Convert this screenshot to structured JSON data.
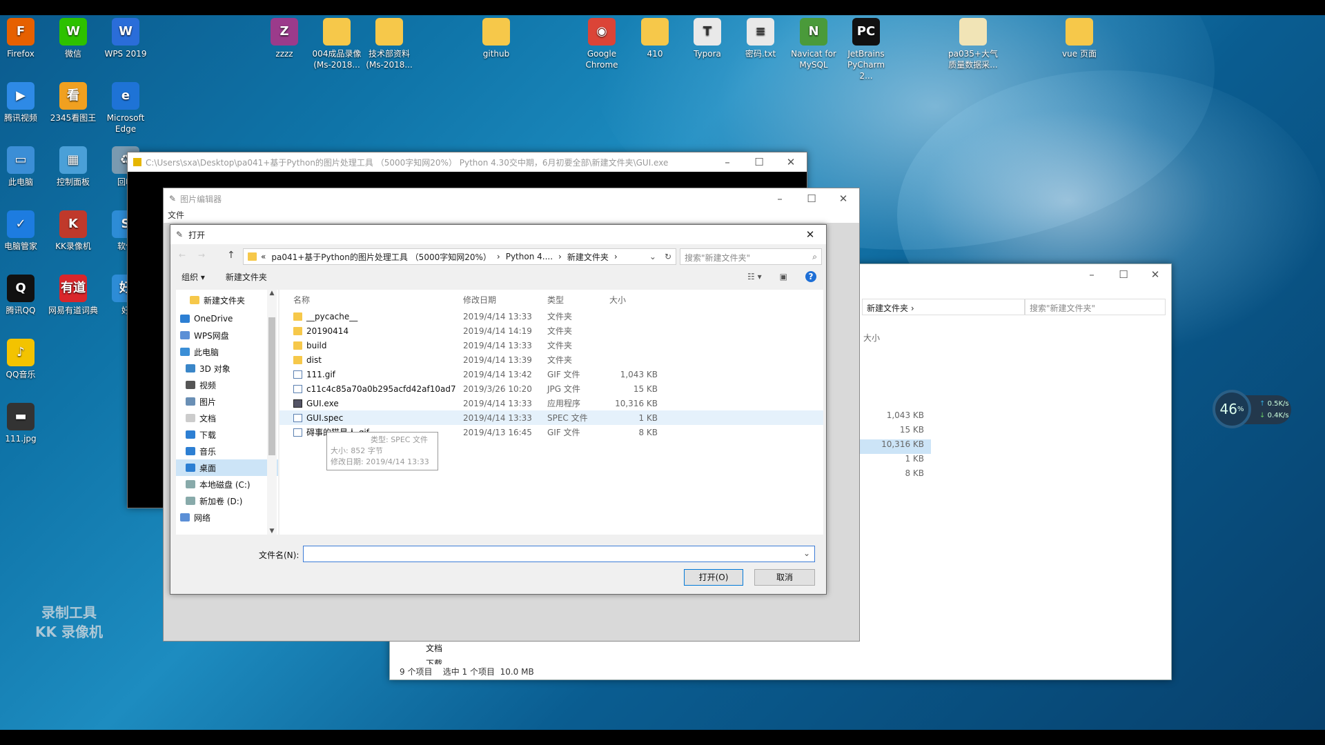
{
  "desktop_icons": [
    {
      "id": "firefox",
      "label": "Firefox",
      "glyph": "F",
      "color": "#e66000"
    },
    {
      "id": "wechat",
      "label": "微信",
      "glyph": "W",
      "color": "#2dc100"
    },
    {
      "id": "wps",
      "label": "WPS 2019",
      "glyph": "W",
      "color": "#2a6dd9"
    },
    {
      "id": "zzzz",
      "label": "zzzz",
      "glyph": "Z",
      "color": "#9b3b8b"
    },
    {
      "id": "rec004",
      "label": "004成品录像\n(Ms-2018...",
      "glyph": "",
      "color": "#f6c84a"
    },
    {
      "id": "tech",
      "label": "技术部资料\n(Ms-2018...",
      "glyph": "",
      "color": "#f6c84a"
    },
    {
      "id": "github",
      "label": "github",
      "glyph": "",
      "color": "#f6c84a"
    },
    {
      "id": "chrome",
      "label": "Google\nChrome",
      "glyph": "◉",
      "color": "#db4437"
    },
    {
      "id": "f410",
      "label": "410",
      "glyph": "",
      "color": "#f6c84a"
    },
    {
      "id": "typora",
      "label": "Typora",
      "glyph": "T",
      "color": "#e9e9e9"
    },
    {
      "id": "pwd",
      "label": "密码.txt",
      "glyph": "≡",
      "color": "#e9e9e9"
    },
    {
      "id": "navicat",
      "label": "Navicat for\nMySQL",
      "glyph": "N",
      "color": "#4a9a3a"
    },
    {
      "id": "pycharm",
      "label": "JetBrains\nPyCharm 2...",
      "glyph": "PC",
      "color": "#111"
    },
    {
      "id": "pa035",
      "label": "pa035+大气\n质量数据采...",
      "glyph": "",
      "color": "#f1e4b6"
    },
    {
      "id": "vue",
      "label": "vue 页面",
      "glyph": "",
      "color": "#f6c84a"
    },
    {
      "id": "tencentvideo",
      "label": "腾讯视频",
      "glyph": "▶",
      "color": "#2e8ae6"
    },
    {
      "id": "viewer2345",
      "label": "2345看图王",
      "glyph": "看",
      "color": "#f0a020"
    },
    {
      "id": "edge",
      "label": "Microsoft\nEdge",
      "glyph": "e",
      "color": "#1e73d6"
    },
    {
      "id": "thispc",
      "label": "此电脑",
      "glyph": "▭",
      "color": "#3b8ed6"
    },
    {
      "id": "controlpanel",
      "label": "控制面板",
      "glyph": "▦",
      "color": "#4aa0d8"
    },
    {
      "id": "recycle",
      "label": "回收",
      "glyph": "♻",
      "color": "#7a9ab0"
    },
    {
      "id": "pcmanager",
      "label": "电脑管家",
      "glyph": "✓",
      "color": "#1d7ce0"
    },
    {
      "id": "kkrec",
      "label": "KK录像机",
      "glyph": "K",
      "color": "#c0392b"
    },
    {
      "id": "software",
      "label": "软件",
      "glyph": "S",
      "color": "#2d8cd6"
    },
    {
      "id": "qq",
      "label": "腾讯QQ",
      "glyph": "Q",
      "color": "#111"
    },
    {
      "id": "youdao",
      "label": "网易有道词典",
      "glyph": "有道",
      "color": "#d9262b"
    },
    {
      "id": "good",
      "label": "好",
      "glyph": "好",
      "color": "#2d8cd6"
    },
    {
      "id": "qqmusic",
      "label": "QQ音乐",
      "glyph": "♪",
      "color": "#f3c300"
    },
    {
      "id": "img111",
      "label": "111.jpg",
      "glyph": "▬",
      "color": "#333"
    }
  ],
  "console_title": "C:\\Users\\sxa\\Desktop\\pa041+基于Python的图片处理工具 （5000字知网20%）   Python 4.30交中期，6月初要全部\\新建文件夹\\GUI.exe",
  "editor": {
    "title": "图片编辑器",
    "menu_file": "文件"
  },
  "dialog": {
    "title": "打开",
    "address": {
      "overflow": "«",
      "crumb1": "pa041+基于Python的图片处理工具 （5000字知网20%）",
      "crumb2": "Python 4....",
      "crumb3": "新建文件夹"
    },
    "search_placeholder": "搜索\"新建文件夹\"",
    "organize": "组织 ▾",
    "new_folder": "新建文件夹",
    "nav_items": [
      {
        "label": "新建文件夹",
        "color": "#f6c84a",
        "indent": 20
      },
      {
        "label": "OneDrive",
        "color": "#2d7fd3",
        "indent": 6
      },
      {
        "label": "WPS网盘",
        "color": "#5b8fd6",
        "indent": 6
      },
      {
        "label": "此电脑",
        "color": "#3b8ed6",
        "indent": 6
      },
      {
        "label": "3D 对象",
        "color": "#3a86c8",
        "indent": 14
      },
      {
        "label": "视频",
        "color": "#555",
        "indent": 14
      },
      {
        "label": "图片",
        "color": "#6a8fb5",
        "indent": 14
      },
      {
        "label": "文档",
        "color": "#ccc",
        "indent": 14
      },
      {
        "label": "下载",
        "color": "#2d7fd3",
        "indent": 14
      },
      {
        "label": "音乐",
        "color": "#2d7fd3",
        "indent": 14
      },
      {
        "label": "桌面",
        "color": "#2d7fd3",
        "indent": 14
      },
      {
        "label": "本地磁盘 (C:)",
        "color": "#8aa",
        "indent": 14
      },
      {
        "label": "新加卷 (D:)",
        "color": "#8aa",
        "indent": 14
      },
      {
        "label": "网络",
        "color": "#5b8fd6",
        "indent": 6
      }
    ],
    "columns": {
      "name": "名称",
      "date": "修改日期",
      "type": "类型",
      "size": "大小"
    },
    "files": [
      {
        "name": "__pycache__",
        "date": "2019/4/14 13:33",
        "type": "文件夹",
        "size": "",
        "kind": "folder"
      },
      {
        "name": "20190414",
        "date": "2019/4/14 14:19",
        "type": "文件夹",
        "size": "",
        "kind": "folder"
      },
      {
        "name": "build",
        "date": "2019/4/14 13:33",
        "type": "文件夹",
        "size": "",
        "kind": "folder"
      },
      {
        "name": "dist",
        "date": "2019/4/14 13:39",
        "type": "文件夹",
        "size": "",
        "kind": "folder"
      },
      {
        "name": "111.gif",
        "date": "2019/4/14 13:42",
        "type": "GIF 文件",
        "size": "1,043 KB",
        "kind": "doc"
      },
      {
        "name": "c11c4c85a70a0b295acfd42af10ad7e.j...",
        "date": "2019/3/26 10:20",
        "type": "JPG 文件",
        "size": "15 KB",
        "kind": "doc"
      },
      {
        "name": "GUI.exe",
        "date": "2019/4/14 13:33",
        "type": "应用程序",
        "size": "10,316 KB",
        "kind": "exe"
      },
      {
        "name": "GUI.spec",
        "date": "2019/4/14 13:33",
        "type": "SPEC 文件",
        "size": "1 KB",
        "kind": "doc",
        "selected": true
      },
      {
        "name": "碍事的猫星人.gif",
        "date": "2019/4/13 16:45",
        "type": "GIF 文件",
        "size": "8 KB",
        "kind": "doc"
      }
    ],
    "tooltip": {
      "type": "类型: SPEC 文件",
      "size": "大小: 852 字节",
      "date": "修改日期: 2019/4/14 13:33"
    },
    "filename_label": "文件名(N):",
    "filename_value": "",
    "open_button": "打开(O)",
    "cancel_button": "取消"
  },
  "explorer_bg": {
    "crumb": "新建文件夹",
    "search_placeholder": "搜索\"新建文件夹\"",
    "size_header": "大小",
    "sizes": [
      "1,043 KB",
      "15 KB",
      "10,316 KB",
      "1 KB",
      "8 KB"
    ],
    "tree_items": [
      "文档",
      "下载"
    ],
    "status": "9 个项目    选中 1 个项目  10.0 MB"
  },
  "net_meter": {
    "percent": "46",
    "unit": "%",
    "up": "0.5K/s",
    "down": "0.4K/s"
  },
  "watermark": {
    "line1": "录制工具",
    "line2": "KK 录像机"
  }
}
